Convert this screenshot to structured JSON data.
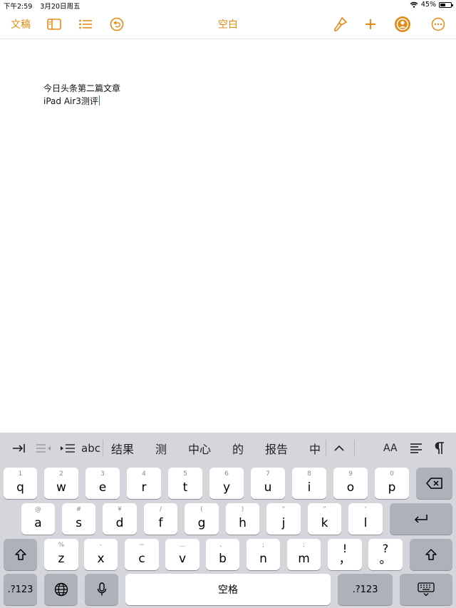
{
  "status": {
    "time": "下午2:59",
    "date": "3月20日周五",
    "battery": "45%",
    "battery_level": 0.45
  },
  "toolbar": {
    "documents_label": "文稿",
    "title": "空白"
  },
  "document": {
    "line1": "今日头条第二篇文章",
    "line2": "iPad Air3测评"
  },
  "suggestions": {
    "format_abc": "abc",
    "words": [
      "结果",
      "测",
      "中心",
      "的",
      "报告",
      "中"
    ],
    "font_size": "AA"
  },
  "keyboard": {
    "row1": [
      {
        "hint": "1",
        "key": "q"
      },
      {
        "hint": "2",
        "key": "w"
      },
      {
        "hint": "3",
        "key": "e"
      },
      {
        "hint": "4",
        "key": "r"
      },
      {
        "hint": "5",
        "key": "t"
      },
      {
        "hint": "6",
        "key": "y"
      },
      {
        "hint": "7",
        "key": "u"
      },
      {
        "hint": "8",
        "key": "i"
      },
      {
        "hint": "9",
        "key": "o"
      },
      {
        "hint": "0",
        "key": "p"
      }
    ],
    "row2": [
      {
        "hint": "@",
        "key": "a"
      },
      {
        "hint": "#",
        "key": "s"
      },
      {
        "hint": "¥",
        "key": "d"
      },
      {
        "hint": "/",
        "key": "f"
      },
      {
        "hint": "(",
        "key": "g"
      },
      {
        "hint": ")",
        "key": "h"
      },
      {
        "hint": "“",
        "key": "j"
      },
      {
        "hint": "”",
        "key": "k"
      },
      {
        "hint": "'",
        "key": "l"
      }
    ],
    "row3": [
      {
        "hint": "%",
        "key": "z"
      },
      {
        "hint": "-",
        "key": "x"
      },
      {
        "hint": "~",
        "key": "c"
      },
      {
        "hint": "…",
        "key": "v"
      },
      {
        "hint": "、",
        "key": "b"
      },
      {
        "hint": ";",
        "key": "n"
      },
      {
        "hint": ":",
        "key": "m"
      },
      {
        "hint": "!",
        "key": "，"
      },
      {
        "hint": "?",
        "key": "。"
      }
    ],
    "num_label": ".?123",
    "space_label": "空格"
  },
  "colors": {
    "accent": "#e48b15",
    "keyboard_bg": "#d4d6db",
    "caret": "#2f6fd6"
  }
}
